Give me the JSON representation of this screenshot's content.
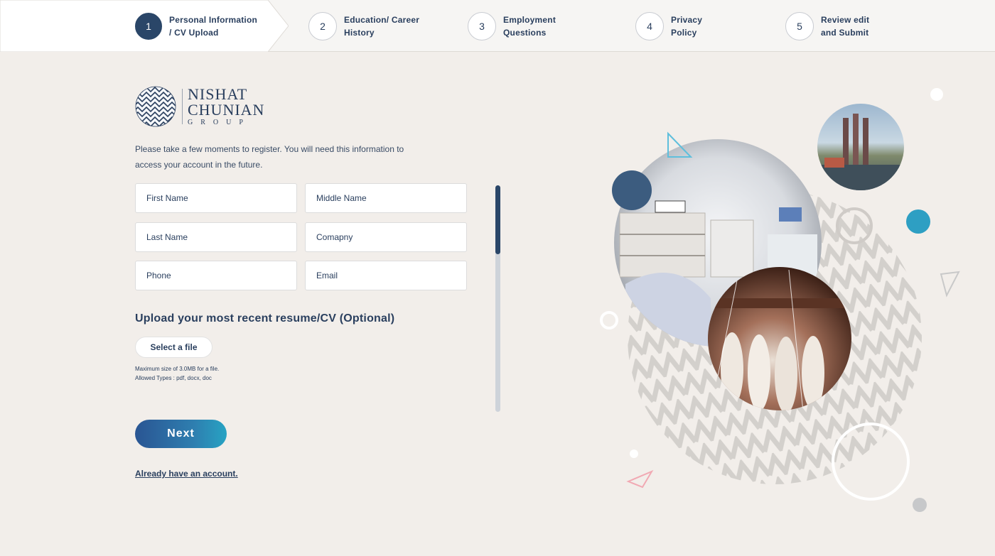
{
  "stepper": {
    "steps": [
      {
        "num": "1",
        "label": "Personal Information\n/ CV Upload",
        "active": true
      },
      {
        "num": "2",
        "label": "Education/ Career\nHistory",
        "active": false
      },
      {
        "num": "3",
        "label": "Employment\nQuestions",
        "active": false
      },
      {
        "num": "4",
        "label": "Privacy\nPolicy",
        "active": false
      },
      {
        "num": "5",
        "label": "Review edit\nand Submit",
        "active": false
      }
    ]
  },
  "logo": {
    "line1": "NISHAT",
    "line2": "CHUNIAN",
    "line3": "GROUP"
  },
  "intro_text": "Please take a few moments to register. You will need this information to access your account in the future.",
  "form": {
    "first_name": {
      "placeholder": "First Name",
      "value": ""
    },
    "middle_name": {
      "placeholder": "Middle Name",
      "value": ""
    },
    "last_name": {
      "placeholder": "Last Name",
      "value": ""
    },
    "company": {
      "placeholder": "Comapny",
      "value": ""
    },
    "phone": {
      "placeholder": "Phone",
      "value": ""
    },
    "email": {
      "placeholder": "Email",
      "value": ""
    }
  },
  "upload": {
    "title": "Upload your most recent resume/CV (Optional)",
    "button_label": "Select a file",
    "note": "Maximum size of 3.0MB for a file.\nAllowed Types : pdf, docx, doc"
  },
  "actions": {
    "next_label": "Next",
    "login_link": "Already have an account."
  },
  "colors": {
    "primary": "#2a4668",
    "accent": "#2e9fc3",
    "background": "#f2eeea"
  },
  "icons": {
    "logo": "nishat-logo-icon"
  }
}
